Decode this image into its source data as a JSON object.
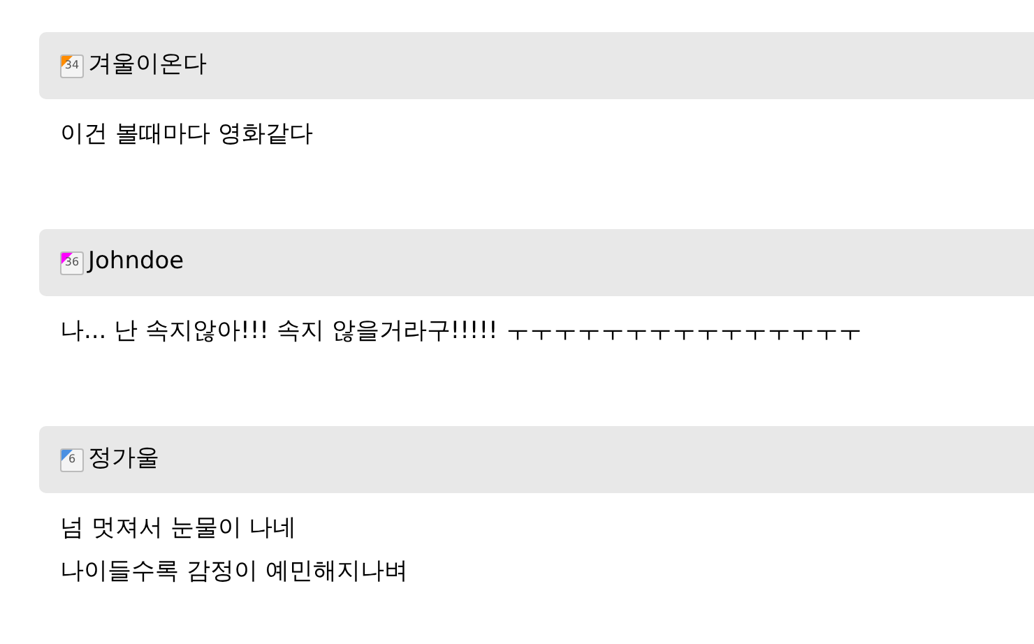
{
  "comments": [
    {
      "author": "겨울이온다",
      "level": "34",
      "color": "#ff8c00",
      "lines": [
        "이건 볼때마다 영화같다"
      ]
    },
    {
      "author": "Johndoe",
      "level": "36",
      "color": "#ff00ff",
      "lines": [
        "나... 난 속지않아!!! 속지 않을거라구!!!!! ㅜㅜㅜㅜㅜㅜㅜㅜㅜㅜㅜㅜㅜㅜㅜ"
      ]
    },
    {
      "author": "정가울",
      "level": "6",
      "color": "#4a90e2",
      "lines": [
        "넘 멋져서 눈물이 나네",
        "나이들수록 감정이 예민해지나벼"
      ]
    }
  ]
}
